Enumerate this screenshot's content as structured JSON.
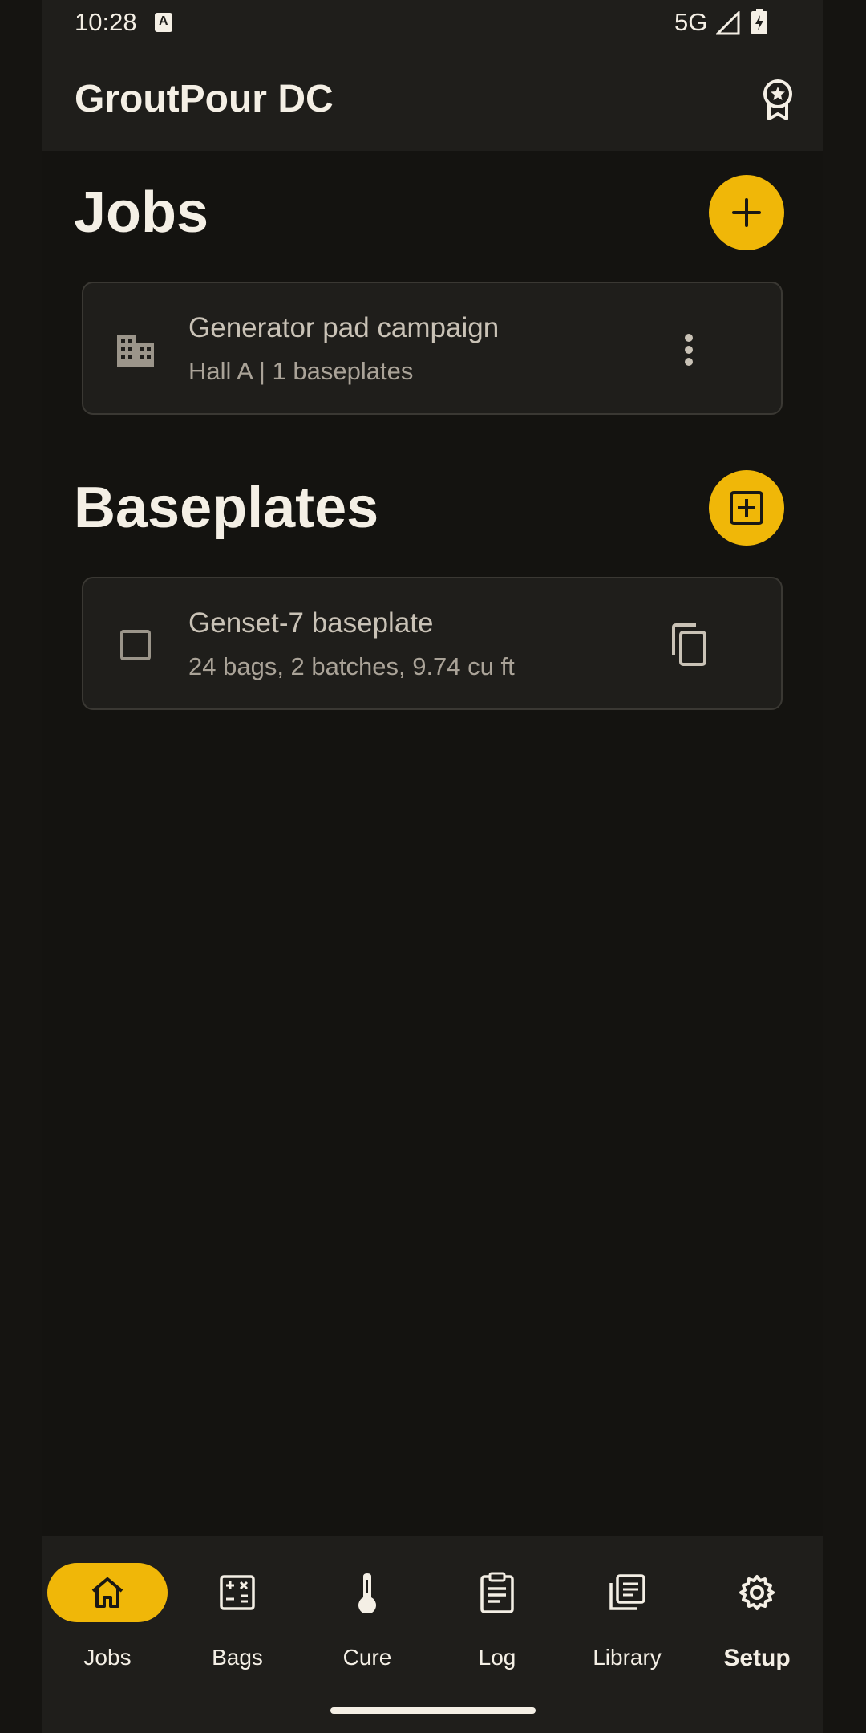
{
  "status": {
    "time": "10:28",
    "network": "5G"
  },
  "app": {
    "title": "GroutPour DC"
  },
  "jobs_section": {
    "title": "Jobs",
    "items": [
      {
        "title": "Generator pad campaign",
        "subtitle": "Hall A  |  1 baseplates"
      }
    ]
  },
  "baseplates_section": {
    "title": "Baseplates",
    "items": [
      {
        "title": "Genset-7 baseplate",
        "subtitle": "24 bags, 2 batches, 9.74 cu ft"
      }
    ]
  },
  "nav": {
    "items": [
      {
        "label": "Jobs",
        "icon": "home-icon",
        "active": true
      },
      {
        "label": "Bags",
        "icon": "calculator-icon"
      },
      {
        "label": "Cure",
        "icon": "thermometer-icon"
      },
      {
        "label": "Log",
        "icon": "clipboard-icon"
      },
      {
        "label": "Library",
        "icon": "library-icon"
      },
      {
        "label": "Setup",
        "icon": "gear-icon"
      }
    ]
  },
  "colors": {
    "accent": "#f0b708",
    "background": "#141310",
    "surface": "#1f1e1b"
  }
}
